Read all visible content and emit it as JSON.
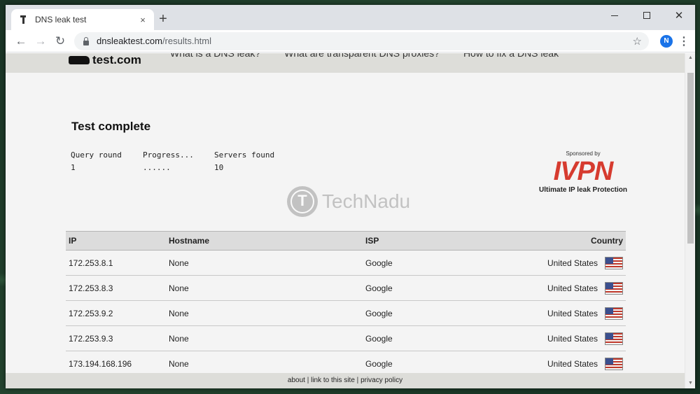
{
  "browser": {
    "tab_title": "DNS leak test",
    "tab_close": "×",
    "new_tab": "+",
    "url_host": "dnsleaktest.com",
    "url_path": "/results.html",
    "profile_initial": "N",
    "back": "←",
    "forward": "→",
    "reload": "↻",
    "star": "☆",
    "menu": "⋮",
    "minimize": "",
    "maximize": "",
    "close": "✕"
  },
  "site": {
    "logo_text": "test.com",
    "nav": [
      "What is a DNS leak?",
      "What are transparent DNS proxies?",
      "How to fix a DNS leak"
    ]
  },
  "test": {
    "title": "Test complete",
    "query_round_label": "Query round",
    "query_round_value": "1",
    "progress_label": "Progress...",
    "progress_value": "......",
    "servers_found_label": "Servers found",
    "servers_found_value": "10"
  },
  "sponsor": {
    "by": "Sponsored by",
    "name": "IVPN",
    "tagline": "Ultimate IP leak Protection",
    "color": "#d63b2f"
  },
  "watermark": {
    "text": "TechNadu"
  },
  "results": {
    "headers": {
      "ip": "IP",
      "hostname": "Hostname",
      "isp": "ISP",
      "country": "Country"
    },
    "rows": [
      {
        "ip": "172.253.8.1",
        "hostname": "None",
        "isp": "Google",
        "country": "United States",
        "flag": "us-flag-icon"
      },
      {
        "ip": "172.253.8.3",
        "hostname": "None",
        "isp": "Google",
        "country": "United States",
        "flag": "us-flag-icon"
      },
      {
        "ip": "172.253.9.2",
        "hostname": "None",
        "isp": "Google",
        "country": "United States",
        "flag": "us-flag-icon"
      },
      {
        "ip": "172.253.9.3",
        "hostname": "None",
        "isp": "Google",
        "country": "United States",
        "flag": "us-flag-icon"
      },
      {
        "ip": "173.194.168.196",
        "hostname": "None",
        "isp": "Google",
        "country": "United States",
        "flag": "us-flag-icon"
      }
    ]
  },
  "footer": {
    "about": "about",
    "link": "link to this site",
    "privacy": "privacy policy",
    "sep": " | "
  }
}
